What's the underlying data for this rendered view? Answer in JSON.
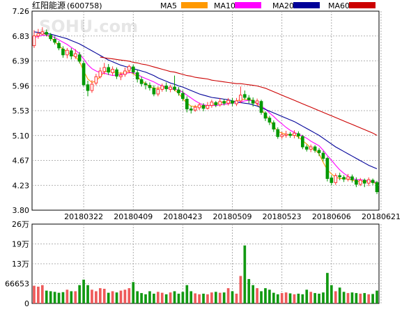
{
  "header": {
    "stock_name": "红阳能源",
    "stock_code": "(600758)",
    "legend": [
      {
        "name": "MA5",
        "color": "#ff9900"
      },
      {
        "name": "MA10",
        "color": "#ff00ff"
      },
      {
        "name": "MA20",
        "color": "#000099"
      },
      {
        "name": "MA60",
        "color": "#cc0000"
      }
    ]
  },
  "watermark": "SOHU.com",
  "colors": {
    "up": "#ff3333",
    "down": "#009900",
    "vol_up": "#ee5a5a",
    "vol_down": "#119911",
    "grid": "#999999",
    "axis": "#000000"
  },
  "chart_data": [
    {
      "type": "candlestick",
      "title": "",
      "y_ticks": [
        "7.26",
        "6.83",
        "6.39",
        "5.96",
        "5.53",
        "5.10",
        "4.67",
        "4.23",
        "3.80"
      ],
      "ylim": [
        3.8,
        7.26
      ],
      "x_ticks": [
        {
          "label": "20180322",
          "index": 12
        },
        {
          "label": "20180409",
          "index": 24
        },
        {
          "label": "20180423",
          "index": 36
        },
        {
          "label": "20180509",
          "index": 48
        },
        {
          "label": "20180523",
          "index": 60
        },
        {
          "label": "20180606",
          "index": 72
        },
        {
          "label": "20180621",
          "index": 84
        }
      ],
      "candles": [
        [
          6.66,
          6.83,
          6.93,
          6.62
        ],
        [
          6.83,
          6.87,
          6.95,
          6.78
        ],
        [
          6.86,
          6.9,
          6.98,
          6.84
        ],
        [
          6.89,
          6.86,
          6.94,
          6.82
        ],
        [
          6.84,
          6.78,
          6.88,
          6.74
        ],
        [
          6.77,
          6.72,
          6.82,
          6.68
        ],
        [
          6.7,
          6.62,
          6.74,
          6.58
        ],
        [
          6.6,
          6.5,
          6.65,
          6.45
        ],
        [
          6.5,
          6.58,
          6.62,
          6.44
        ],
        [
          6.57,
          6.48,
          6.62,
          6.42
        ],
        [
          6.47,
          6.52,
          6.6,
          6.43
        ],
        [
          6.5,
          6.39,
          6.55,
          6.35
        ],
        [
          6.35,
          5.98,
          6.4,
          5.95
        ],
        [
          5.98,
          5.88,
          6.05,
          5.78
        ],
        [
          5.88,
          5.99,
          6.06,
          5.84
        ],
        [
          6.01,
          6.12,
          6.17,
          5.97
        ],
        [
          6.12,
          6.22,
          6.28,
          6.09
        ],
        [
          6.21,
          6.28,
          6.36,
          6.16
        ],
        [
          6.28,
          6.2,
          6.34,
          6.15
        ],
        [
          6.19,
          6.25,
          6.3,
          6.14
        ],
        [
          6.24,
          6.13,
          6.28,
          6.08
        ],
        [
          6.12,
          6.15,
          6.2,
          6.06
        ],
        [
          6.16,
          6.22,
          6.28,
          6.12
        ],
        [
          6.23,
          6.3,
          6.33,
          6.18
        ],
        [
          6.29,
          6.2,
          6.33,
          6.16
        ],
        [
          6.19,
          6.08,
          6.24,
          6.02
        ],
        [
          6.07,
          6.0,
          6.12,
          5.95
        ],
        [
          6.0,
          5.98,
          6.04,
          5.9
        ],
        [
          5.97,
          5.93,
          6.02,
          5.88
        ],
        [
          5.92,
          5.82,
          5.97,
          5.78
        ],
        [
          5.82,
          5.9,
          5.95,
          5.78
        ],
        [
          5.9,
          5.96,
          6.0,
          5.86
        ],
        [
          5.96,
          5.91,
          6.02,
          5.86
        ],
        [
          5.9,
          5.94,
          5.98,
          5.85
        ],
        [
          5.94,
          5.9,
          6.14,
          5.87
        ],
        [
          5.89,
          5.84,
          5.94,
          5.79
        ],
        [
          5.83,
          5.74,
          5.88,
          5.7
        ],
        [
          5.73,
          5.56,
          5.78,
          5.5
        ],
        [
          5.56,
          5.54,
          5.61,
          5.48
        ],
        [
          5.54,
          5.59,
          5.63,
          5.51
        ],
        [
          5.58,
          5.63,
          5.67,
          5.54
        ],
        [
          5.62,
          5.57,
          5.66,
          5.52
        ],
        [
          5.57,
          5.62,
          5.68,
          5.55
        ],
        [
          5.62,
          5.68,
          5.72,
          5.58
        ],
        [
          5.67,
          5.63,
          5.7,
          5.59
        ],
        [
          5.63,
          5.69,
          5.75,
          5.6
        ],
        [
          5.69,
          5.66,
          5.73,
          5.62
        ],
        [
          5.66,
          5.71,
          5.75,
          5.62
        ],
        [
          5.7,
          5.66,
          5.75,
          5.61
        ],
        [
          5.65,
          5.7,
          5.75,
          5.61
        ],
        [
          5.7,
          5.8,
          5.95,
          5.66
        ],
        [
          5.81,
          5.76,
          5.88,
          5.72
        ],
        [
          5.75,
          5.72,
          5.8,
          5.66
        ],
        [
          5.71,
          5.66,
          5.76,
          5.6
        ],
        [
          5.66,
          5.7,
          5.74,
          5.62
        ],
        [
          5.69,
          5.5,
          5.72,
          5.46
        ],
        [
          5.49,
          5.4,
          5.52,
          5.35
        ],
        [
          5.4,
          5.33,
          5.44,
          5.28
        ],
        [
          5.32,
          5.21,
          5.36,
          5.16
        ],
        [
          5.2,
          5.08,
          5.24,
          5.04
        ],
        [
          5.08,
          5.11,
          5.16,
          5.04
        ],
        [
          5.1,
          5.12,
          5.18,
          5.06
        ],
        [
          5.12,
          5.1,
          5.16,
          5.06
        ],
        [
          5.1,
          5.14,
          5.19,
          5.05
        ],
        [
          5.13,
          5.09,
          5.17,
          5.04
        ],
        [
          5.08,
          4.9,
          5.11,
          4.86
        ],
        [
          4.9,
          4.86,
          4.94,
          4.82
        ],
        [
          4.86,
          4.9,
          4.94,
          4.81
        ],
        [
          4.9,
          4.84,
          4.93,
          4.8
        ],
        [
          4.84,
          4.8,
          4.88,
          4.74
        ],
        [
          4.79,
          4.7,
          4.83,
          4.65
        ],
        [
          4.7,
          4.35,
          4.73,
          4.3
        ],
        [
          4.36,
          4.28,
          4.41,
          4.23
        ],
        [
          4.28,
          4.4,
          4.44,
          4.24
        ],
        [
          4.4,
          4.38,
          4.45,
          4.32
        ],
        [
          4.37,
          4.34,
          4.41,
          4.29
        ],
        [
          4.34,
          4.38,
          4.43,
          4.3
        ],
        [
          4.38,
          4.33,
          4.42,
          4.28
        ],
        [
          4.32,
          4.25,
          4.37,
          4.2
        ],
        [
          4.25,
          4.32,
          4.36,
          4.22
        ],
        [
          4.32,
          4.27,
          4.35,
          4.2
        ],
        [
          4.27,
          4.33,
          4.37,
          4.22
        ],
        [
          4.32,
          4.28,
          4.35,
          4.24
        ],
        [
          4.28,
          4.12,
          4.31,
          4.08
        ]
      ],
      "ma": {
        "MA5": [
          6.8,
          6.86,
          6.88,
          6.85,
          6.8,
          6.73,
          6.66,
          6.6,
          6.55,
          6.51,
          6.47,
          6.38,
          6.22,
          6.08,
          6.02,
          6.05,
          6.12,
          6.2,
          6.23,
          6.21,
          6.19,
          6.18,
          6.19,
          6.21,
          6.17,
          6.12,
          6.05,
          6.0,
          5.95,
          5.92,
          5.92,
          5.93,
          5.93,
          5.92,
          5.89,
          5.83,
          5.74,
          5.66,
          5.61,
          5.6,
          5.6,
          5.6,
          5.61,
          5.64,
          5.65,
          5.67,
          5.68,
          5.68,
          5.68,
          5.7,
          5.72,
          5.73,
          5.72,
          5.71,
          5.64,
          5.55,
          5.46,
          5.37,
          5.26,
          5.17,
          5.14,
          5.12,
          5.11,
          5.11,
          5.07,
          5.01,
          4.95,
          4.88,
          4.85,
          4.78,
          4.63,
          4.5,
          4.43,
          4.37,
          4.35,
          4.35,
          4.34,
          4.32,
          4.3,
          4.3,
          4.3,
          4.3,
          4.29,
          4.25
        ],
        "MA10": [
          6.8,
          6.82,
          6.84,
          6.84,
          6.83,
          6.8,
          6.76,
          6.72,
          6.68,
          6.63,
          6.58,
          6.52,
          6.43,
          6.33,
          6.26,
          6.22,
          6.19,
          6.18,
          6.16,
          6.14,
          6.15,
          6.16,
          6.17,
          6.19,
          6.19,
          6.16,
          6.12,
          6.09,
          6.06,
          6.03,
          5.99,
          5.96,
          5.93,
          5.91,
          5.9,
          5.89,
          5.85,
          5.8,
          5.75,
          5.7,
          5.66,
          5.63,
          5.62,
          5.62,
          5.62,
          5.63,
          5.64,
          5.65,
          5.66,
          5.67,
          5.68,
          5.7,
          5.71,
          5.7,
          5.66,
          5.61,
          5.56,
          5.49,
          5.43,
          5.36,
          5.3,
          5.24,
          5.19,
          5.15,
          5.12,
          5.09,
          5.05,
          5.0,
          4.96,
          4.92,
          4.84,
          4.75,
          4.67,
          4.58,
          4.5,
          4.44,
          4.39,
          4.35,
          4.33,
          4.33,
          4.32,
          4.31,
          4.3,
          4.28
        ],
        "MA20": [
          6.9,
          6.89,
          6.88,
          6.87,
          6.86,
          6.84,
          6.82,
          6.8,
          6.78,
          6.75,
          6.72,
          6.69,
          6.65,
          6.61,
          6.57,
          6.53,
          6.49,
          6.45,
          6.41,
          6.38,
          6.35,
          6.32,
          6.3,
          6.28,
          6.26,
          6.24,
          6.22,
          6.2,
          6.17,
          6.14,
          6.1,
          6.07,
          6.04,
          6.01,
          5.99,
          5.96,
          5.94,
          5.91,
          5.88,
          5.85,
          5.82,
          5.8,
          5.78,
          5.76,
          5.75,
          5.74,
          5.73,
          5.72,
          5.7,
          5.68,
          5.67,
          5.66,
          5.65,
          5.63,
          5.61,
          5.58,
          5.55,
          5.52,
          5.49,
          5.46,
          5.43,
          5.4,
          5.37,
          5.34,
          5.3,
          5.26,
          5.22,
          5.18,
          5.14,
          5.1,
          5.05,
          5.0,
          4.95,
          4.9,
          4.86,
          4.82,
          4.78,
          4.74,
          4.7,
          4.66,
          4.62,
          4.58,
          4.55,
          4.52
        ],
        "MA60": [
          null,
          null,
          null,
          null,
          null,
          null,
          null,
          null,
          null,
          null,
          null,
          null,
          null,
          null,
          null,
          null,
          6.46,
          6.45,
          6.44,
          6.43,
          6.42,
          6.41,
          6.4,
          6.39,
          6.37,
          6.36,
          6.34,
          6.33,
          6.31,
          6.29,
          6.27,
          6.25,
          6.23,
          6.21,
          6.2,
          6.18,
          6.16,
          6.14,
          6.13,
          6.11,
          6.1,
          6.09,
          6.08,
          6.06,
          6.05,
          6.04,
          6.03,
          6.02,
          6.01,
          6.0,
          6.0,
          5.99,
          5.98,
          5.97,
          5.96,
          5.94,
          5.92,
          5.89,
          5.86,
          5.83,
          5.8,
          5.77,
          5.74,
          5.71,
          5.68,
          5.65,
          5.62,
          5.59,
          5.56,
          5.53,
          5.5,
          5.47,
          5.44,
          5.41,
          5.38,
          5.35,
          5.32,
          5.29,
          5.26,
          5.23,
          5.2,
          5.17,
          5.14,
          5.1
        ]
      }
    },
    {
      "type": "bar",
      "title": "",
      "y_ticks": [
        "26万",
        "19万",
        "13万",
        "66653",
        "0"
      ],
      "ylim": [
        0,
        260000
      ],
      "values": [
        58000,
        55000,
        60000,
        42000,
        40000,
        38000,
        35000,
        37000,
        45000,
        40000,
        40000,
        60000,
        78000,
        60000,
        45000,
        40000,
        50000,
        48000,
        35000,
        40000,
        36000,
        42000,
        45000,
        50000,
        70000,
        40000,
        34000,
        30000,
        40000,
        32000,
        38000,
        35000,
        30000,
        36000,
        40000,
        32000,
        38000,
        60000,
        40000,
        33000,
        30000,
        32000,
        30000,
        36000,
        38000,
        35000,
        36000,
        50000,
        40000,
        32000,
        90000,
        190000,
        80000,
        60000,
        50000,
        40000,
        50000,
        45000,
        35000,
        30000,
        34000,
        36000,
        33000,
        30000,
        32000,
        30000,
        45000,
        38000,
        34000,
        32000,
        36000,
        100000,
        60000,
        40000,
        52000,
        38000,
        34000,
        36000,
        34000,
        32000,
        34000,
        30000,
        31000,
        42000
      ]
    }
  ]
}
